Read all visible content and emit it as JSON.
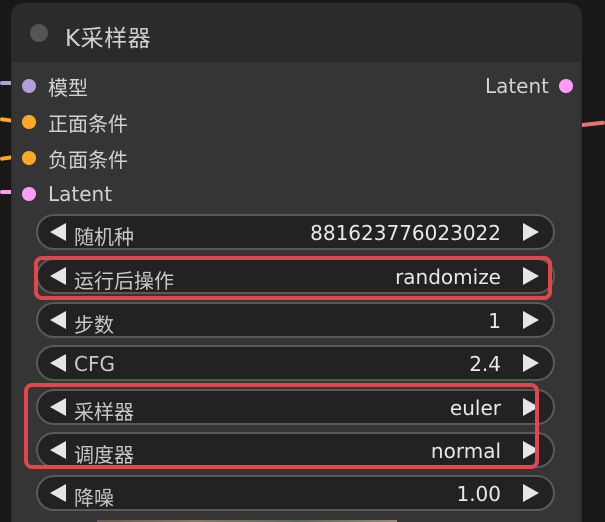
{
  "node": {
    "title": "K采样器"
  },
  "inputs": [
    {
      "label": "模型",
      "color": "#b39ddb"
    },
    {
      "label": "正面条件",
      "color": "#ffa726"
    },
    {
      "label": "负面条件",
      "color": "#ffa726"
    },
    {
      "label": "Latent",
      "color": "#ff9cf9"
    }
  ],
  "outputs": [
    {
      "label": "Latent",
      "color": "#ff9cf9"
    }
  ],
  "widgets": [
    {
      "label": "随机种",
      "value": "881623776023022"
    },
    {
      "label": "运行后操作",
      "value": "randomize"
    },
    {
      "label": "步数",
      "value": "1"
    },
    {
      "label": "CFG",
      "value": "2.4"
    },
    {
      "label": "采样器",
      "value": "euler"
    },
    {
      "label": "调度器",
      "value": "normal"
    },
    {
      "label": "降噪",
      "value": "1.00"
    }
  ],
  "colors": {
    "highlight": "#e0474c",
    "node_bg": "#353535",
    "header_bg": "#2b2b2b"
  }
}
